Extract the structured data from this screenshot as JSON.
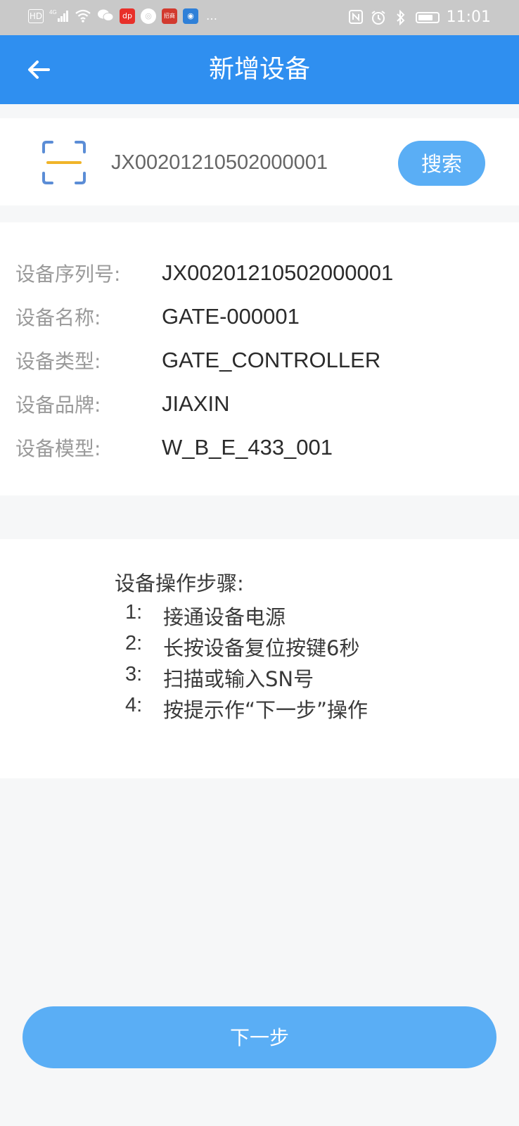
{
  "status_bar": {
    "left_icons": [
      "HD",
      "4G",
      "signal",
      "wifi",
      "wechat",
      "app-red",
      "app-circle",
      "app-red2",
      "app-blue",
      "..."
    ],
    "time": "11:01",
    "right_icons": [
      "nfc-icon",
      "alarm-icon",
      "bluetooth-icon",
      "battery-icon"
    ]
  },
  "app_bar": {
    "title": "新增设备",
    "back_icon": "arrow-left-icon"
  },
  "search": {
    "scan_icon": "scan-icon",
    "sn_value": "JX00201210502000001",
    "button_label": "搜索"
  },
  "device_info": [
    {
      "label": "设备序列号:",
      "value": "JX00201210502000001"
    },
    {
      "label": "设备名称:",
      "value": "GATE-000001"
    },
    {
      "label": "设备类型:",
      "value": "GATE_CONTROLLER"
    },
    {
      "label": "设备品牌:",
      "value": "JIAXIN"
    },
    {
      "label": "设备模型:",
      "value": "W_B_E_433_001"
    }
  ],
  "steps": {
    "title": "设备操作步骤:",
    "items": [
      {
        "num": "1:",
        "text": "接通设备电源"
      },
      {
        "num": "2:",
        "text": "长按设备复位按键6秒"
      },
      {
        "num": "3:",
        "text": "扫描或输入SN号"
      },
      {
        "num": "4:",
        "text": "按提示作“下一步”操作"
      }
    ]
  },
  "next_button": {
    "label": "下一步"
  },
  "colors": {
    "primary": "#2f8ff0",
    "button": "#5aaef5",
    "scan_corner": "#5b8dd6",
    "scan_line": "#f0b429"
  }
}
